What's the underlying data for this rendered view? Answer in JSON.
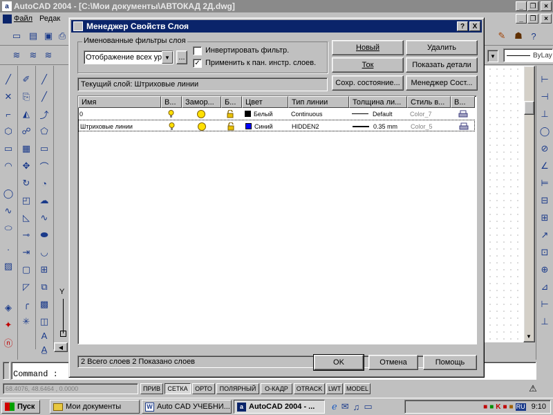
{
  "app": {
    "title": "AutoCAD 2004 - [C:\\Мои документы\\АВТОКАД 2Д.dwg]",
    "menu": [
      "Файл",
      "Редак"
    ],
    "bylayer": "ByLay"
  },
  "dialog": {
    "title": "Менеджер Свойств Слоя",
    "help_btn": "?",
    "close_btn": "X",
    "filters_group_label": "Именованные фильтры слоя",
    "filter_value": "Отображение всех ур",
    "filter_browse": "...",
    "invert_filter_label": "Инвертировать фильтр.",
    "invert_filter_checked": false,
    "apply_toolbar_label": "Применить к пан. инстр. слоев.",
    "apply_toolbar_checked": true,
    "buttons": {
      "new": "Новый",
      "delete": "Удалить",
      "current": "Ток",
      "show_details": "Показать детали",
      "save_state": "Сохр. состояние...",
      "state_manager": "Менеджер Сост..."
    },
    "current_layer": "Текущий слой: Штриховые линии",
    "columns": [
      "Имя",
      "В...",
      "Замор...",
      "Б...",
      "Цвет",
      "Тип линии",
      "Толщина ли...",
      "Стиль в...",
      "В..."
    ],
    "rows": [
      {
        "name": "0",
        "color_name": "Белый",
        "color_hex": "#000000",
        "linetype": "Continuous",
        "lineweight": "Default",
        "plot_style": "Color_7"
      },
      {
        "name": "Штриховые линии",
        "color_name": "Синий",
        "color_hex": "#0000ff",
        "linetype": "HIDDEN2",
        "lineweight": "0.35 mm",
        "plot_style": "Color_5"
      }
    ],
    "status": "2 Всего слоев   2 Показано слоев",
    "ok": "OK",
    "cancel": "Отмена",
    "help": "Помощь"
  },
  "command": {
    "prompt": "Command :"
  },
  "statusbar": {
    "coords": "68.4076, 48.6464 , 0.0000",
    "modes": [
      {
        "label": "ПРИВ",
        "on": false
      },
      {
        "label": "СЕТКА",
        "on": true
      },
      {
        "label": "ОРТО",
        "on": false
      },
      {
        "label": "ПОЛЯРНЫЙ",
        "on": false
      },
      {
        "label": "О-КАДР",
        "on": false
      },
      {
        "label": "OTRACK",
        "on": false
      },
      {
        "label": "LWT",
        "on": false
      },
      {
        "label": "MODEL",
        "on": false
      }
    ]
  },
  "taskbar": {
    "start": "Пуск",
    "tasks": [
      {
        "label": "Мои документы",
        "active": false
      },
      {
        "label": "Auto CAD УЧЕБНИ...",
        "active": false
      },
      {
        "label": "AutoCAD 2004 - ...",
        "active": true
      }
    ],
    "lang": "RU",
    "clock": "9:10"
  },
  "axis": {
    "y": "Y"
  }
}
